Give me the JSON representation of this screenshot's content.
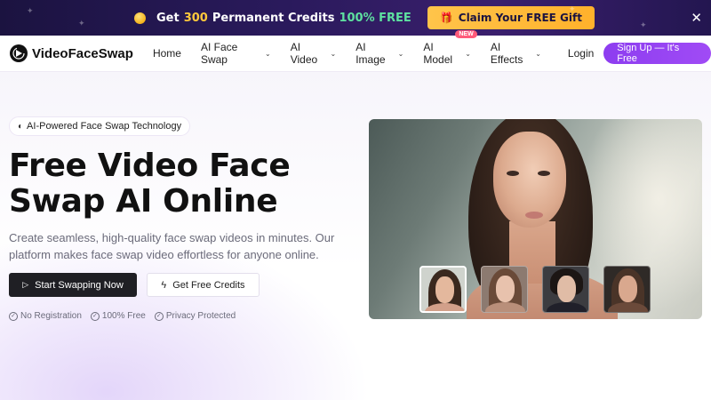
{
  "promo": {
    "text_prefix": "Get",
    "credits_amount": "300",
    "text_middle": "Permanent Credits",
    "free_label": "100% FREE",
    "claim_button": "Claim Your FREE Gift",
    "close_glyph": "✕",
    "icon_coin": "coin-icon",
    "icon_gift": "gift-icon"
  },
  "nav": {
    "brand": "VideoFaceSwap",
    "items": [
      {
        "label": "Home",
        "dropdown": false
      },
      {
        "label": "AI Face Swap",
        "dropdown": true
      },
      {
        "label": "AI Video",
        "dropdown": true
      },
      {
        "label": "AI Image",
        "dropdown": true
      },
      {
        "label": "AI Model",
        "dropdown": true,
        "badge": "NEW"
      },
      {
        "label": "AI Effects",
        "dropdown": true
      }
    ],
    "login": "Login",
    "signup": "Sign Up — It's Free"
  },
  "hero": {
    "badge": "AI-Powered Face Swap Technology",
    "title": "Free Video Face Swap AI Online",
    "subtitle": "Create seamless, high-quality face swap videos in minutes. Our platform makes face swap video effortless for anyone online.",
    "primary_button": "Start Swapping Now",
    "secondary_button": "Get Free Credits",
    "trust": [
      {
        "label": "No Registration"
      },
      {
        "label": "100% Free"
      },
      {
        "label": "Privacy Protected"
      }
    ]
  },
  "preview": {
    "thumbnails": [
      {
        "name": "face-thumbnail-1",
        "selected": true
      },
      {
        "name": "face-thumbnail-2",
        "selected": false
      },
      {
        "name": "face-thumbnail-3",
        "selected": false
      },
      {
        "name": "face-thumbnail-4",
        "selected": false
      }
    ]
  },
  "colors": {
    "promo_bg": "#2a1a5c",
    "accent_yellow": "#ffc93c",
    "accent_green": "#5ee0a0",
    "signup_purple": "#9a45f3",
    "primary_button": "#1f1f24"
  }
}
